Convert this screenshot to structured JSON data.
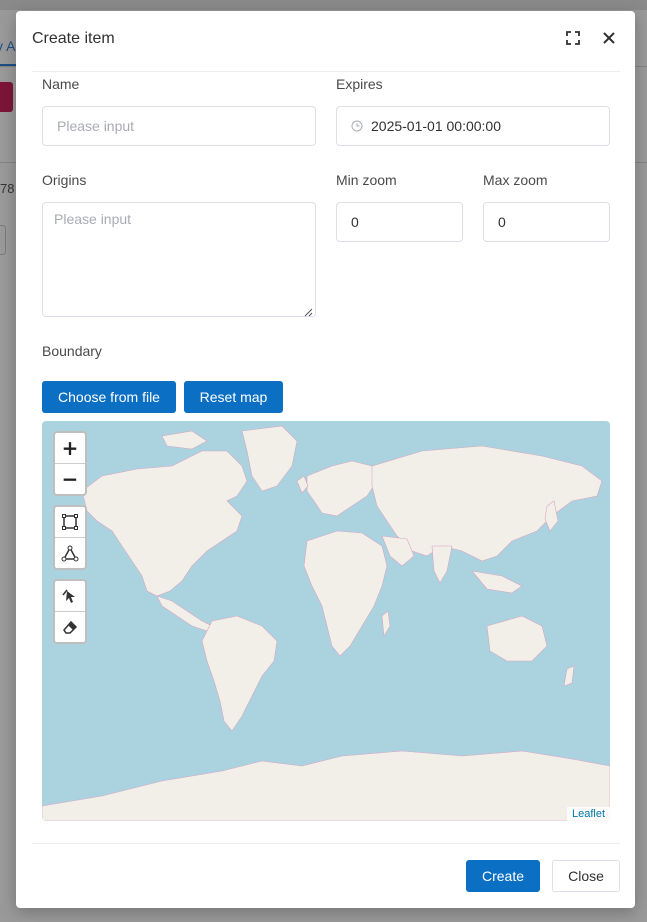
{
  "background": {
    "tab_fragment": "y A",
    "number_fragment": "78"
  },
  "dialog": {
    "title": "Create item",
    "fullscreen_icon": "fullscreen-icon",
    "close_icon": "close-icon"
  },
  "form": {
    "name": {
      "label": "Name",
      "placeholder": "Please input",
      "value": ""
    },
    "expires": {
      "label": "Expires",
      "value": "2025-01-01 00:00:00",
      "icon": "clock-icon"
    },
    "origins": {
      "label": "Origins",
      "placeholder": "Please input",
      "value": ""
    },
    "min_zoom": {
      "label": "Min zoom",
      "value": "0"
    },
    "max_zoom": {
      "label": "Max zoom",
      "value": "0"
    },
    "boundary": {
      "label": "Boundary"
    }
  },
  "buttons": {
    "choose_from_file": "Choose from file",
    "reset_map": "Reset map",
    "create": "Create",
    "close": "Close"
  },
  "map": {
    "zoom_in": "+",
    "zoom_out": "−",
    "attribution": "Leaflet",
    "tools": [
      "rectangle-draw-icon",
      "polygon-draw-icon",
      "edit-layers-icon",
      "eraser-icon"
    ],
    "colors": {
      "water": "#abd3df",
      "land": "#f2efe9",
      "border": "#d7a6c4"
    }
  },
  "colors": {
    "primary": "#0b6fc4",
    "input_border": "#dcdfe6",
    "placeholder": "#a8abb2"
  }
}
